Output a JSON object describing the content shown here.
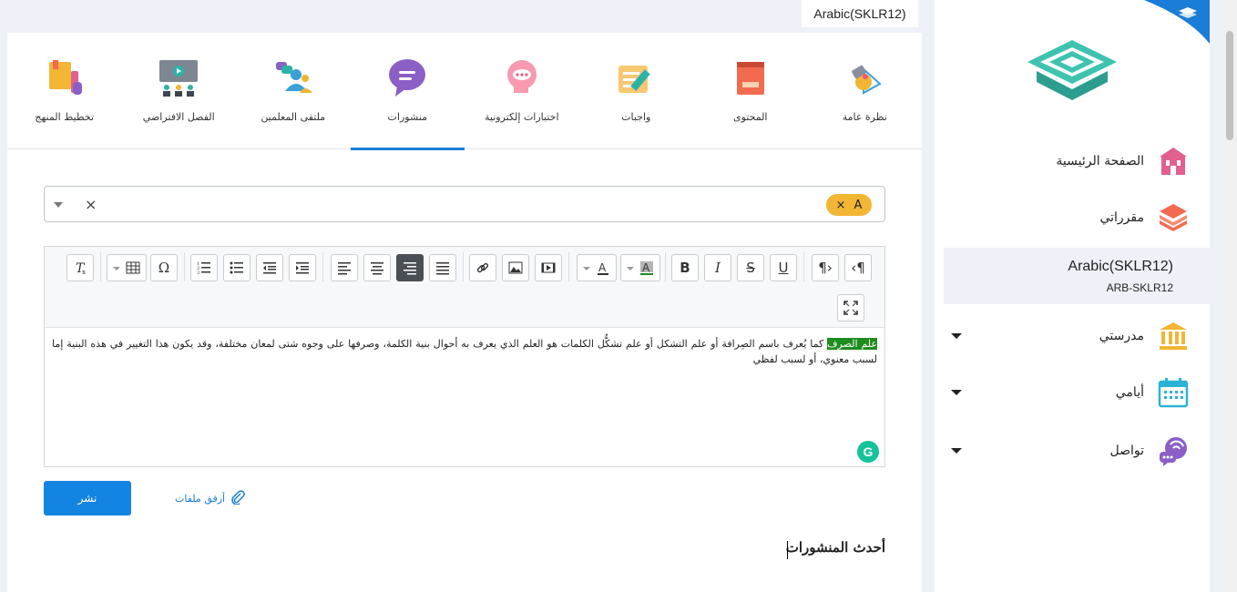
{
  "header": {
    "course_badge": "Arabic(SKLR12)"
  },
  "tabs": [
    {
      "label": "نظرة عامة",
      "icon": "overview-icon"
    },
    {
      "label": "المحتوى",
      "icon": "book-icon"
    },
    {
      "label": "واجبات",
      "icon": "assignment-icon"
    },
    {
      "label": "اختبارات إلكترونية",
      "icon": "quiz-icon"
    },
    {
      "label": "منشورات",
      "icon": "chat-bubble-icon",
      "active": true
    },
    {
      "label": "ملتقى المعلمين",
      "icon": "teachers-icon"
    },
    {
      "label": "الفصل الافتراضي",
      "icon": "virtual-class-icon"
    },
    {
      "label": "تخطيط المنهج",
      "icon": "curriculum-icon"
    }
  ],
  "tag_select": {
    "chip_label": "A",
    "chip_remove": "×",
    "clear": "×"
  },
  "editor": {
    "highlight": "علم الصرف",
    "body": " كما يُعرف باسم الصِرافة أو علم التشكل أو علم تشكُّل الكلمات هو العلم الذي يعرف به أحوال بنية الكلمة، وصرفها على وجوه شتى لمعان مختلفة، وقد يكون هذا التغيير في هذه البنية إما لسبب معنوي، أو لسبب لفظي",
    "grammarly": "G"
  },
  "actions": {
    "publish_label": "نشر",
    "attach_label": "أرفق ملفات"
  },
  "latest": {
    "title": "أحدث المنشورات"
  },
  "sidebar": {
    "items": [
      {
        "label": "الصفحة الرئيسية",
        "icon": "home-icon"
      },
      {
        "label": "مقرراتي",
        "icon": "stack-icon"
      },
      {
        "label": "مدرستي",
        "icon": "school-icon",
        "dropdown": true
      },
      {
        "label": "أيامي",
        "icon": "calendar-icon",
        "dropdown": true
      },
      {
        "label": "تواصل",
        "icon": "communication-icon",
        "dropdown": true
      }
    ],
    "course": {
      "title": "Arabic(SKLR12)",
      "code": "ARB-SKLR12"
    }
  }
}
